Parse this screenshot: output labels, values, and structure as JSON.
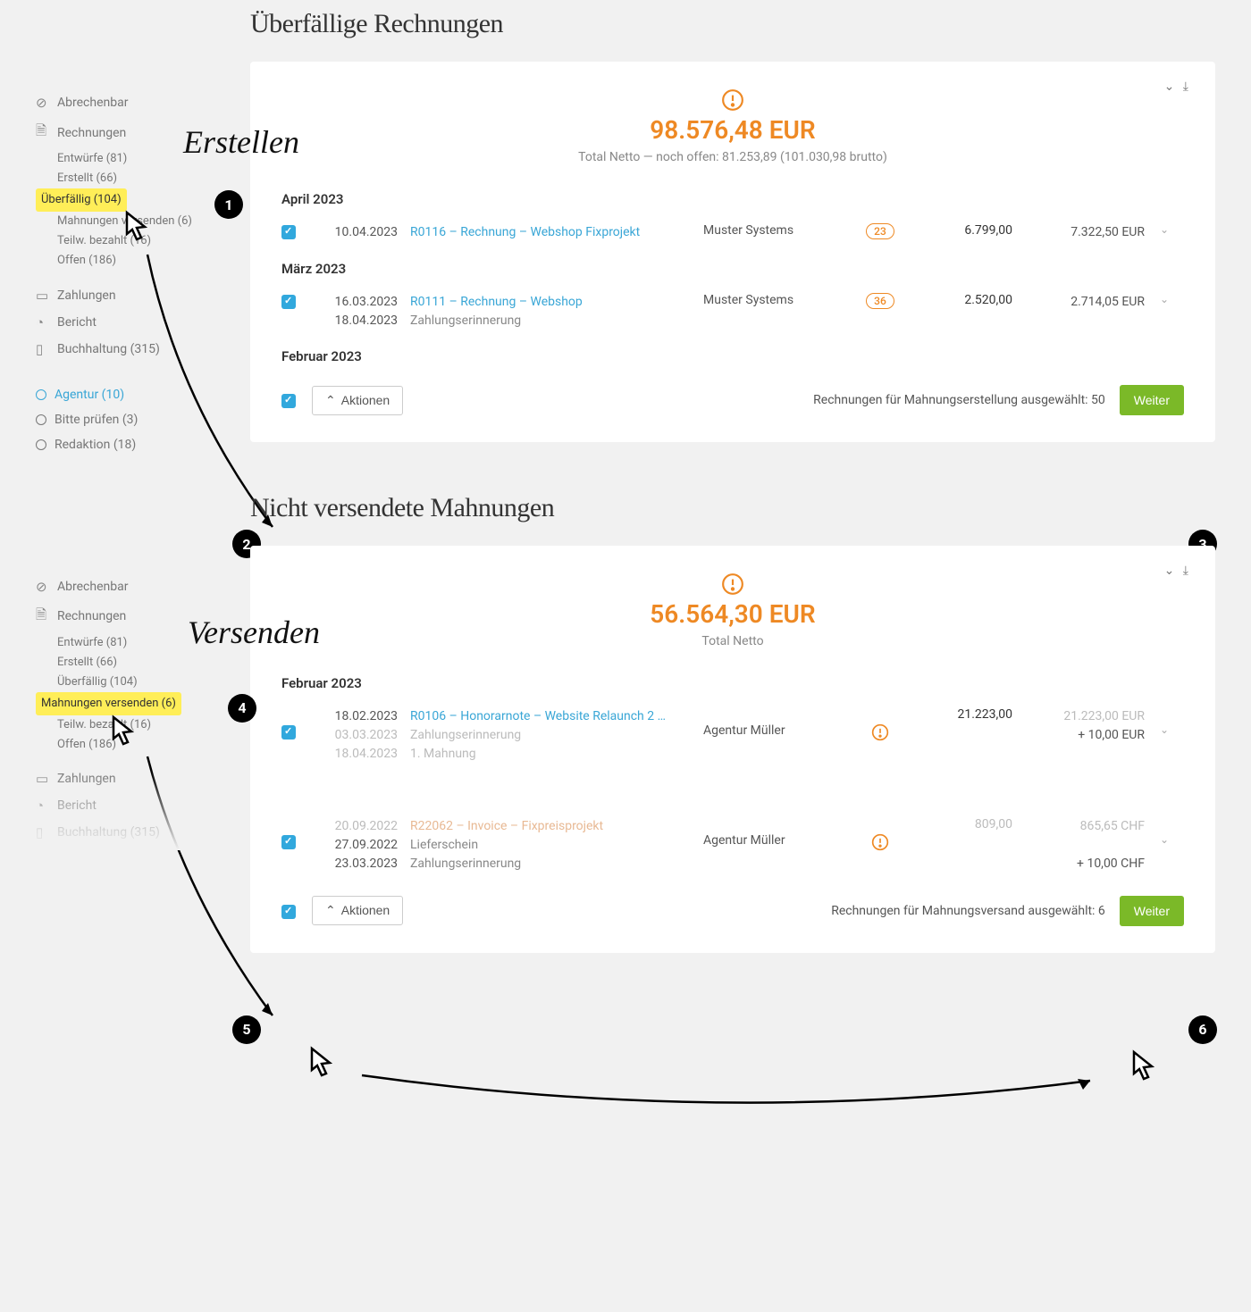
{
  "annotations": {
    "erstellen": "Erstellen",
    "versenden": "Versenden"
  },
  "shot1": {
    "title": "Überfällige Rechnungen",
    "sidebar": {
      "abrechenbar": "Abrechenbar",
      "rechnungen": "Rechnungen",
      "subs": {
        "entwuerfe": "Entwürfe (81)",
        "erstellt": "Erstellt (66)",
        "ueberfaellig": "Überfällig (104)",
        "mahnungen": "Mahnungen versenden (6)",
        "teilw": "Teilw. bezahlt (16)",
        "offen": "Offen (186)"
      },
      "zahlungen": "Zahlungen",
      "bericht": "Bericht",
      "buchhaltung": "Buchhaltung (315)",
      "agentur": "Agentur (10)",
      "bitte": "Bitte prüfen (3)",
      "redaktion": "Redaktion (18)"
    },
    "hero": {
      "amount": "98.576,48 EUR",
      "sub": "Total Netto — noch offen: 81.253,89 (101.030,98 brutto)"
    },
    "month_april": "April 2023",
    "row_april": {
      "date": "10.04.2023",
      "obj": "R0116 – Rechnung – Webshop Fixprojekt",
      "cust": "Muster Systems",
      "badge": "23",
      "net": "6.799,00",
      "gross": "7.322,50 EUR"
    },
    "month_maerz": "März 2023",
    "row_maerz": {
      "date1": "16.03.2023",
      "date2": "18.04.2023",
      "obj": "R0111 – Rechnung – Webshop",
      "sub": "Zahlungserinnerung",
      "cust": "Muster Systems",
      "badge": "36",
      "net": "2.520,00",
      "gross": "2.714,05 EUR"
    },
    "month_feb": "Februar 2023",
    "footer": {
      "actions": "Aktionen",
      "text": "Rechnungen für Mahnungserstellung ausgewählt: 50",
      "weiter": "Weiter"
    }
  },
  "shot2": {
    "title": "Nicht versendete Mahnungen",
    "sidebar": {
      "abrechenbar": "Abrechenbar",
      "rechnungen": "Rechnungen",
      "subs": {
        "entwuerfe": "Entwürfe (81)",
        "erstellt": "Erstellt (66)",
        "ueberfaellig": "Überfällig (104)",
        "mahnungen": "Mahnungen versenden (6)",
        "teilw": "Teilw. bezahlt (16)",
        "offen": "Offen (186)"
      },
      "zahlungen": "Zahlungen",
      "bericht": "Bericht",
      "buchhaltung": "Buchhaltung (315)"
    },
    "hero": {
      "amount": "56.564,30 EUR",
      "sub": "Total Netto"
    },
    "month_feb": "Februar 2023",
    "row1": {
      "date1": "18.02.2023",
      "date2": "03.03.2023",
      "date3": "18.04.2023",
      "obj": "R0106 – Honorarnote – Website Relaunch 2 …",
      "sub1": "Zahlungserinnerung",
      "sub2": "1. Mahnung",
      "cust": "Agentur Müller",
      "net": "21.223,00",
      "gross1": "21.223,00 EUR",
      "gross2": "+ 10,00 EUR"
    },
    "row2": {
      "date1": "20.09.2022",
      "date2": "27.09.2022",
      "date3": "23.03.2023",
      "obj": "R22062 – Invoice – Fixpreisprojekt",
      "sub1": "Lieferschein",
      "sub2": "Zahlungserinnerung",
      "cust": "Agentur Müller",
      "net": "809,00",
      "gross1": "865,65 CHF",
      "gross2": "+ 10,00 CHF"
    },
    "footer": {
      "actions": "Aktionen",
      "text": "Rechnungen für Mahnungsversand ausgewählt: 6",
      "weiter": "Weiter"
    }
  }
}
